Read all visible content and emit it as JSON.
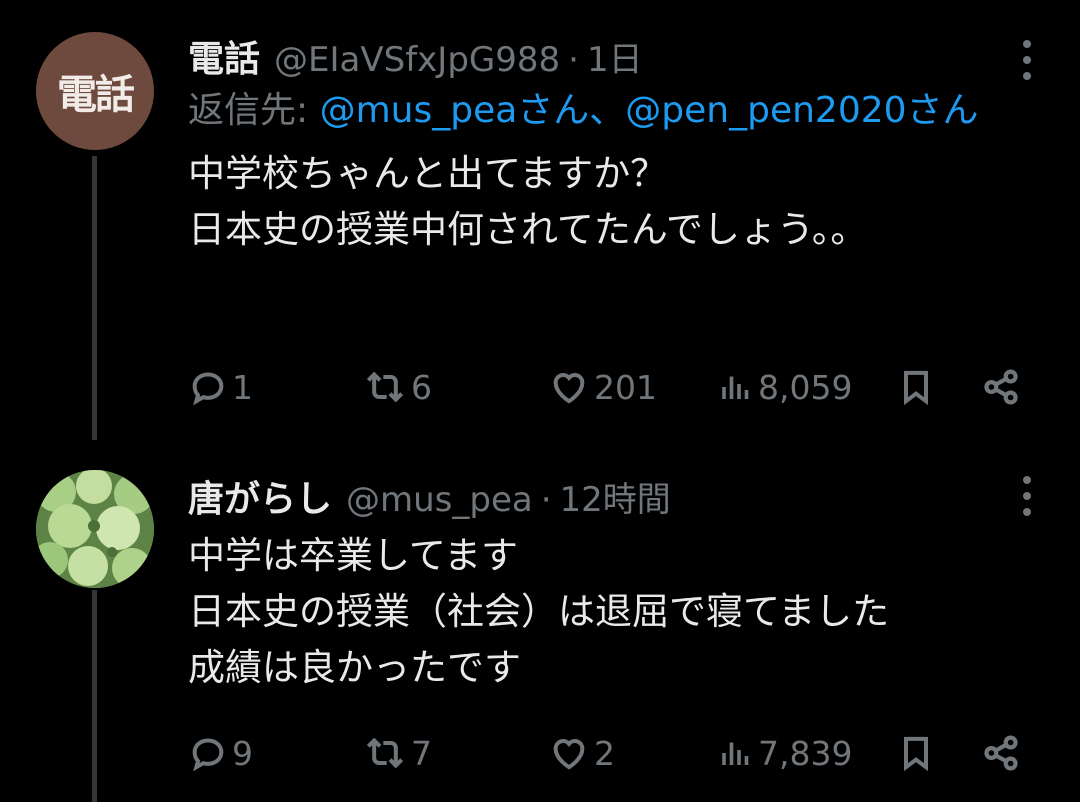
{
  "tweets": [
    {
      "avatar_text": "電話",
      "display_name": "電話",
      "handle": "@EIaVSfxJpG988",
      "separator": "·",
      "time": "1日",
      "reply_prefix": "返信先: ",
      "mention_1": "@mus_peaさん",
      "reply_joiner": "、",
      "mention_2": "@pen_pen2020さん",
      "lines": [
        "中学校ちゃんと出てますか？",
        "日本史の授業中何されてたんでしょう。。"
      ],
      "replies": "1",
      "retweets": "6",
      "likes": "201",
      "views": "8,059"
    },
    {
      "avatar_icon": "vegetable-photo",
      "display_name": "唐がらし",
      "handle": "@mus_pea",
      "separator": "·",
      "time": "12時間",
      "lines": [
        "中学は卒業してます",
        "日本史の授業（社会）は退屈で寝てました",
        "成績は良かったです"
      ],
      "replies": "9",
      "retweets": "7",
      "likes": "2",
      "views": "7,839"
    }
  ],
  "colors": {
    "background": "#000000",
    "text": "#e7e9ea",
    "muted": "#71767b",
    "link": "#1d9bf0",
    "thread_line": "#333639"
  }
}
